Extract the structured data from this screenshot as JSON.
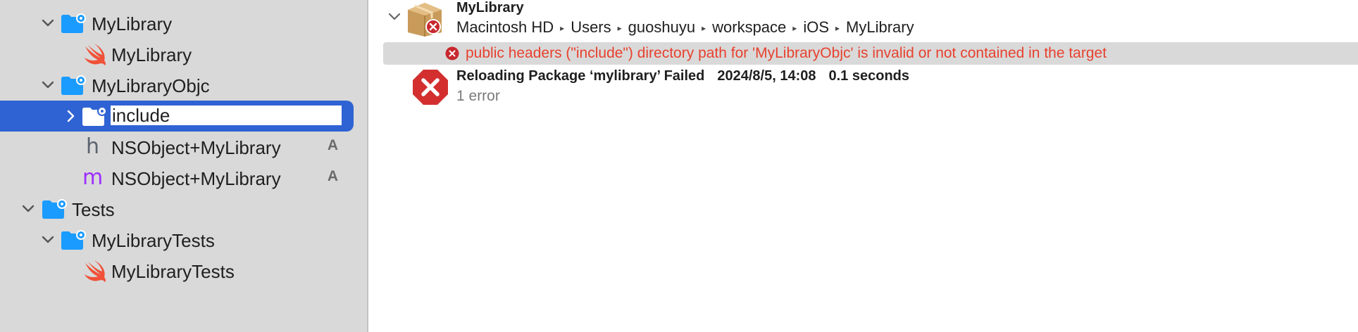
{
  "sidebar": {
    "items": [
      {
        "label": "MyLibrary",
        "kind": "folder",
        "icon": "package-folder-icon",
        "expanded": true
      },
      {
        "label": "MyLibrary",
        "kind": "swift",
        "icon": "swift-icon"
      },
      {
        "label": "MyLibraryObjc",
        "kind": "folder",
        "icon": "package-folder-icon",
        "expanded": true
      },
      {
        "label": "include",
        "kind": "folder",
        "icon": "package-folder-icon",
        "expanded": false,
        "selected": true,
        "editing": true
      },
      {
        "label": "NSObject+MyLibrary",
        "kind": "header",
        "icon": "h-file-icon",
        "glyph": "h",
        "badge": "A"
      },
      {
        "label": "NSObject+MyLibrary",
        "kind": "objc",
        "icon": "m-file-icon",
        "glyph": "m",
        "badge": "A"
      },
      {
        "label": "Tests",
        "kind": "folder",
        "icon": "package-folder-icon",
        "expanded": true
      },
      {
        "label": "MyLibraryTests",
        "kind": "folder",
        "icon": "package-folder-icon",
        "expanded": true
      },
      {
        "label": "MyLibraryTests",
        "kind": "swift",
        "icon": "swift-icon"
      }
    ]
  },
  "main": {
    "package_title": "MyLibrary",
    "breadcrumb": [
      "Macintosh HD",
      "Users",
      "guoshuyu",
      "workspace",
      "iOS",
      "MyLibrary"
    ],
    "error_message": "public headers (\"include\") directory path for 'MyLibraryObjc' is invalid or not contained in the target",
    "reload_title": "Reloading Package ‘mylibrary’ Failed",
    "reload_date": "2024/8/5, 14:08",
    "reload_duration": "0.1 seconds",
    "error_count": "1 error"
  },
  "colors": {
    "selection": "#2f63d3",
    "folder": "#1a9bff",
    "swift": "#f05138",
    "error_text": "#e8412e",
    "error_icon": "#c8282e"
  }
}
